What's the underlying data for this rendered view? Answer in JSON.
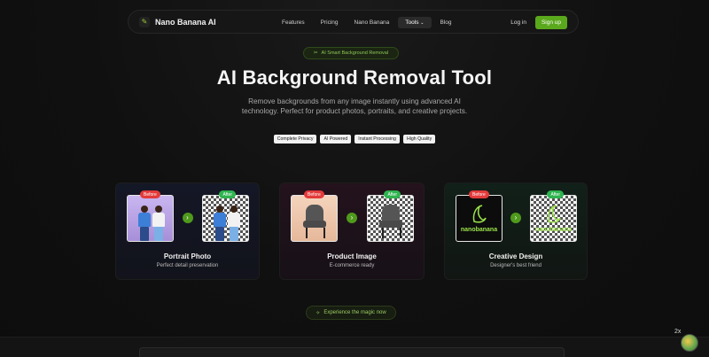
{
  "nav": {
    "brand": "Nano Banana AI",
    "links": [
      "Features",
      "Pricing",
      "Nano Banana",
      "Tools",
      "Blog"
    ],
    "tools_chevron": "⌄",
    "login": "Log in",
    "signup": "Sign up"
  },
  "hero": {
    "pill": "AI Smart Background Removal",
    "title": "AI Background Removal Tool",
    "subtitle": "Remove backgrounds from any image instantly using advanced AI technology. Perfect for product photos, portraits, and creative projects.",
    "tags": [
      "Complete Privacy",
      "AI Powered",
      "Instant Processing",
      "High Quality"
    ]
  },
  "cards": [
    {
      "title": "Portrait Photo",
      "subtitle": "Perfect detail preservation",
      "before": "Before",
      "after": "After"
    },
    {
      "title": "Product Image",
      "subtitle": "E-commerce ready",
      "before": "Before",
      "after": "After"
    },
    {
      "title": "Creative Design",
      "subtitle": "Designer's best friend",
      "before": "Before",
      "after": "After",
      "logo_text": "nanobanana"
    }
  ],
  "cta": {
    "label": "Experience the magic now"
  },
  "zoom": "2x",
  "icons": {
    "brand": "banana-icon",
    "pill": "scissors-icon",
    "arrow": "chevron-right-icon",
    "magic": "sparkle-icon"
  },
  "colors": {
    "accent": "#5aa81c",
    "before_badge": "#e33b3b",
    "after_badge": "#2fb450"
  }
}
